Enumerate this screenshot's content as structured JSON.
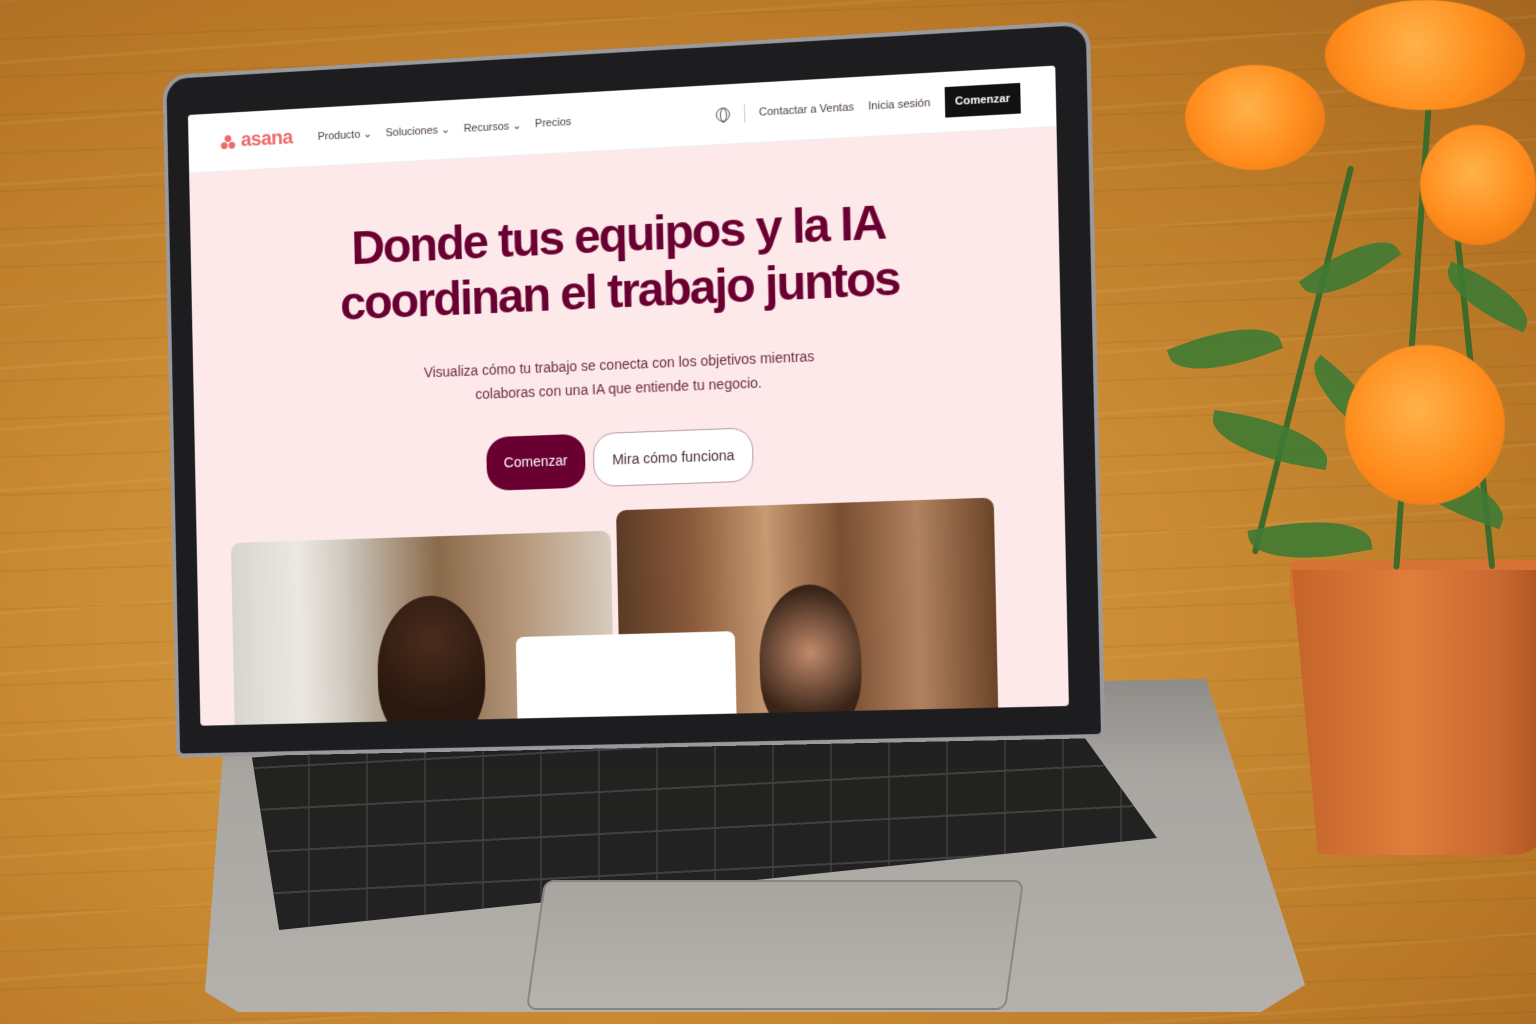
{
  "browser_page": {
    "brand": "asana",
    "nav": {
      "items": [
        {
          "label": "Producto ⌄"
        },
        {
          "label": "Soluciones ⌄"
        },
        {
          "label": "Recursos ⌄"
        },
        {
          "label": "Precios"
        }
      ],
      "contact": "Contactar a Ventas",
      "login": "Inicia sesión",
      "cta": "Comenzar"
    },
    "hero": {
      "title_line1": "Donde tus equipos y la IA",
      "title_line2": "coordinan el trabajo juntos",
      "subtitle_line1": "Visualiza cómo tu trabajo se conecta con los objetivos mientras",
      "subtitle_line2": "colaboras con una IA que entiende tu negocio.",
      "primary_button": "Comenzar",
      "secondary_button": "Mira cómo funciona"
    }
  },
  "colors": {
    "brand_coral": "#f06a6a",
    "hero_text": "#690031",
    "hero_bg": "#fde9ea",
    "cta_dark": "#111111"
  },
  "icons": [
    "globe-icon",
    "asana-logo-icon",
    "chevron-down-icon"
  ]
}
